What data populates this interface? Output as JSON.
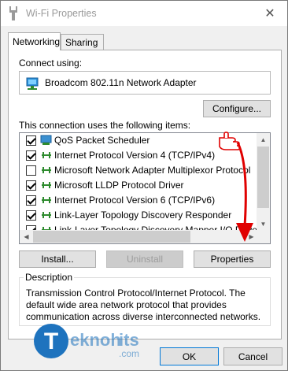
{
  "window": {
    "title": "Wi-Fi Properties",
    "icons": {
      "title": "wifi-adapter-icon",
      "close": "close-icon"
    }
  },
  "tabs": [
    {
      "label": "Networking",
      "active": true
    },
    {
      "label": "Sharing",
      "active": false
    }
  ],
  "networking": {
    "connect_using_label": "Connect using:",
    "adapter_name": "Broadcom 802.11n Network Adapter",
    "configure_label": "Configure...",
    "items_label": "This connection uses the following items:",
    "items": [
      {
        "label": "QoS Packet Scheduler",
        "checked": true,
        "icon": "service-icon"
      },
      {
        "label": "Internet Protocol Version 4 (TCP/IPv4)",
        "checked": true,
        "icon": "protocol-icon"
      },
      {
        "label": "Microsoft Network Adapter Multiplexor Protocol",
        "checked": false,
        "icon": "protocol-icon"
      },
      {
        "label": "Microsoft LLDP Protocol Driver",
        "checked": true,
        "icon": "protocol-icon"
      },
      {
        "label": "Internet Protocol Version 6 (TCP/IPv6)",
        "checked": true,
        "icon": "protocol-icon"
      },
      {
        "label": "Link-Layer Topology Discovery Responder",
        "checked": true,
        "icon": "protocol-icon"
      },
      {
        "label": "Link-Layer Topology Discovery Mapper I/O Driver",
        "checked": true,
        "icon": "protocol-icon"
      }
    ],
    "install_label": "Install...",
    "uninstall_label": "Uninstall",
    "properties_label": "Properties",
    "description_legend": "Description",
    "description_text": "Transmission Control Protocol/Internet Protocol. The default wide area network protocol that provides communication across diverse interconnected networks."
  },
  "footer": {
    "ok_label": "OK",
    "cancel_label": "Cancel"
  },
  "watermark": {
    "letter": "T",
    "text": "eknoh",
    "suffix": "its",
    "domain": ".com"
  },
  "colors": {
    "accent": "#0078d7",
    "annotation_red": "#e00000",
    "watermark": "#1e73be"
  }
}
